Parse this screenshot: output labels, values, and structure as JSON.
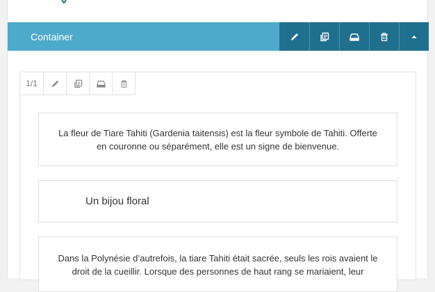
{
  "container": {
    "title": "Container",
    "tools": [
      "pencil-icon",
      "duplicate-icon",
      "save-icon",
      "trash-icon",
      "caret-up-icon"
    ]
  },
  "inner_toolbar": {
    "count": "1/1",
    "tools": [
      "pencil-icon",
      "duplicate-icon",
      "save-icon",
      "trash-icon"
    ]
  },
  "blocks": [
    {
      "text": "La fleur de Tiare Tahiti (Gardenia taitensis) est la fleur symbole de Tahiti. Offerte en couronne ou séparément, elle est un signe de bienvenue."
    },
    {
      "text": "Un bijou floral"
    },
    {
      "text": "Dans la Polynésie d’autrefois, la tiare Tahiti était sacrée, seuls les rois avaient le droit de la cueillir. Lorsque des personnes de haut rang se mariaient, leur"
    }
  ],
  "colors": {
    "bar": "#4eaacb",
    "bar_tools": "#1f6f8f",
    "mark": "#1f6f8f"
  }
}
